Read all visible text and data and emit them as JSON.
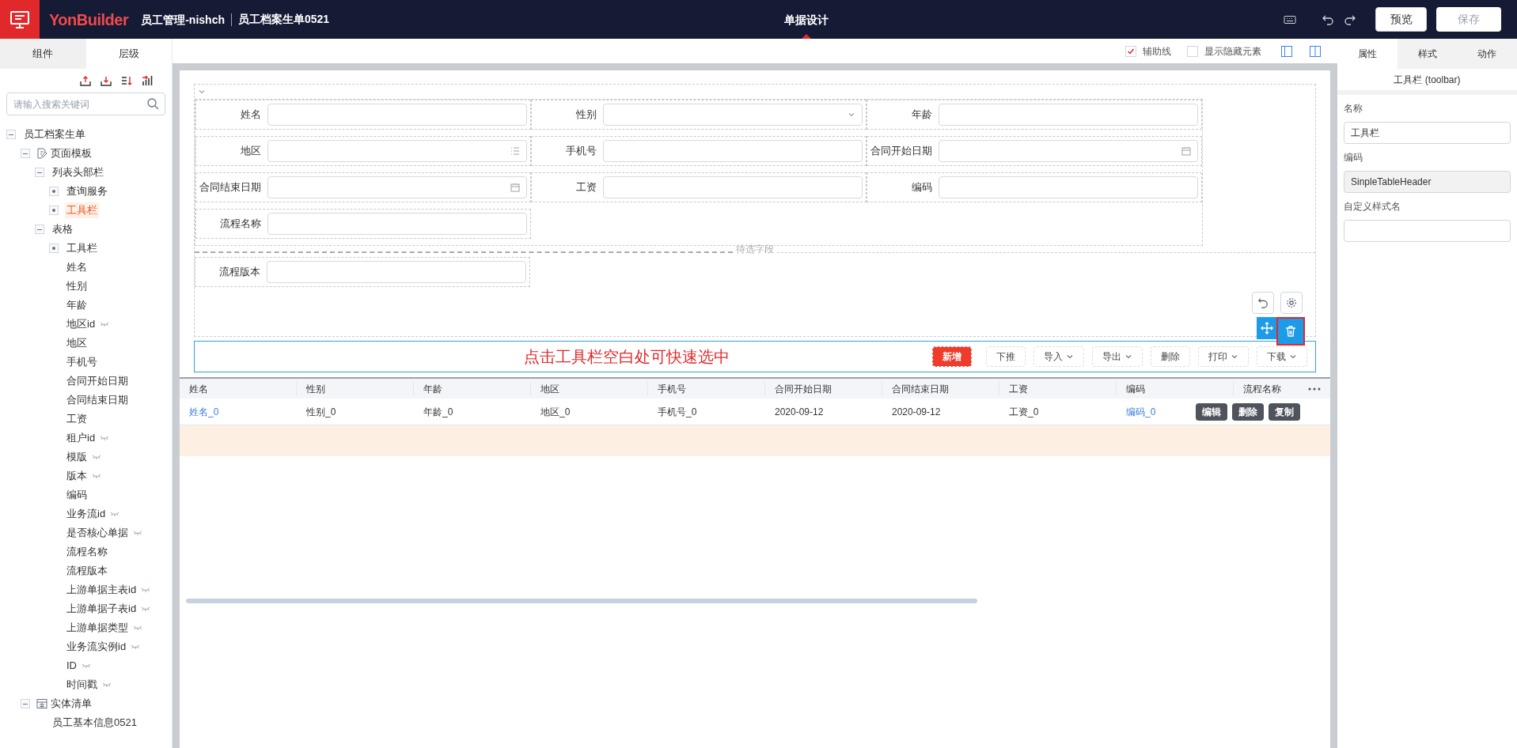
{
  "header": {
    "brand": "YonBuilder",
    "app": "员工管理-nishch",
    "doc": "员工档案生单0521",
    "center_title": "单据设计",
    "buttons": [
      {
        "label": "预览",
        "disabled": false
      },
      {
        "label": "保存",
        "disabled": true
      }
    ]
  },
  "left_tabs": [
    {
      "label": "组件",
      "selected": false
    },
    {
      "label": "层级",
      "selected": true
    }
  ],
  "search": {
    "placeholder": "请输入搜索关键词"
  },
  "tree": [
    {
      "label": "员工档案生单",
      "kind": "node",
      "expanded": true,
      "selected": false,
      "children": [
        {
          "label": "页面模板",
          "kind": "page",
          "expanded": true,
          "selected": false,
          "children": [
            {
              "label": "列表头部栏",
              "kind": "node",
              "expanded": true,
              "selected": false,
              "children": [
                {
                  "label": "查询服务",
                  "kind": "node",
                  "expanded": false,
                  "selected": false
                },
                {
                  "label": "工具栏",
                  "kind": "node",
                  "expanded": false,
                  "selected": true
                }
              ]
            },
            {
              "label": "表格",
              "kind": "node",
              "expanded": true,
              "selected": false,
              "children": [
                {
                  "label": "工具栏",
                  "kind": "node",
                  "expanded": false,
                  "selected": false
                },
                {
                  "label": "姓名",
                  "kind": "field",
                  "hidden": false,
                  "selected": false
                },
                {
                  "label": "性别",
                  "kind": "field",
                  "hidden": false,
                  "selected": false
                },
                {
                  "label": "年龄",
                  "kind": "field",
                  "hidden": false,
                  "selected": false
                },
                {
                  "label": "地区id",
                  "kind": "field",
                  "hidden": true,
                  "selected": false
                },
                {
                  "label": "地区",
                  "kind": "field",
                  "hidden": false,
                  "selected": false
                },
                {
                  "label": "手机号",
                  "kind": "field",
                  "hidden": false,
                  "selected": false
                },
                {
                  "label": "合同开始日期",
                  "kind": "field",
                  "hidden": false,
                  "selected": false
                },
                {
                  "label": "合同结束日期",
                  "kind": "field",
                  "hidden": false,
                  "selected": false
                },
                {
                  "label": "工资",
                  "kind": "field",
                  "hidden": false,
                  "selected": false
                },
                {
                  "label": "租户id",
                  "kind": "field",
                  "hidden": true,
                  "selected": false
                },
                {
                  "label": "模版",
                  "kind": "field",
                  "hidden": true,
                  "selected": false
                },
                {
                  "label": "版本",
                  "kind": "field",
                  "hidden": true,
                  "selected": false
                },
                {
                  "label": "编码",
                  "kind": "field",
                  "hidden": false,
                  "selected": false
                },
                {
                  "label": "业务流id",
                  "kind": "field",
                  "hidden": true,
                  "selected": false
                },
                {
                  "label": "是否核心单据",
                  "kind": "field",
                  "hidden": true,
                  "selected": false
                },
                {
                  "label": "流程名称",
                  "kind": "field",
                  "hidden": false,
                  "selected": false
                },
                {
                  "label": "流程版本",
                  "kind": "field",
                  "hidden": false,
                  "selected": false
                },
                {
                  "label": "上游单据主表id",
                  "kind": "field",
                  "hidden": true,
                  "selected": false
                },
                {
                  "label": "上游单据子表id",
                  "kind": "field",
                  "hidden": true,
                  "selected": false
                },
                {
                  "label": "上游单据类型",
                  "kind": "field",
                  "hidden": true,
                  "selected": false
                },
                {
                  "label": "业务流实例id",
                  "kind": "field",
                  "hidden": true,
                  "selected": false
                },
                {
                  "label": "ID",
                  "kind": "field",
                  "hidden": true,
                  "selected": false
                },
                {
                  "label": "时间戳",
                  "kind": "field",
                  "hidden": true,
                  "selected": false
                }
              ]
            }
          ]
        },
        {
          "label": "实体清单",
          "kind": "entity",
          "expanded": true,
          "selected": false,
          "children": [
            {
              "label": "员工基本信息0521",
              "kind": "field",
              "hidden": false,
              "selected": false
            }
          ]
        }
      ]
    }
  ],
  "canvas_options": [
    {
      "label": "辅助线",
      "checked": true
    },
    {
      "label": "显示隐藏元素",
      "checked": false
    }
  ],
  "form": {
    "fields": [
      {
        "label": "姓名",
        "kind": "text"
      },
      {
        "label": "性别",
        "kind": "select"
      },
      {
        "label": "年龄",
        "kind": "text"
      },
      {
        "label": "地区",
        "kind": "list"
      },
      {
        "label": "手机号",
        "kind": "text"
      },
      {
        "label": "合同开始日期",
        "kind": "date"
      },
      {
        "label": "合同结束日期",
        "kind": "date"
      },
      {
        "label": "工资",
        "kind": "text"
      },
      {
        "label": "编码",
        "kind": "text"
      },
      {
        "label": "流程名称",
        "kind": "text"
      }
    ],
    "pending_label": "待选字段",
    "pending_fields": [
      {
        "label": "流程版本",
        "kind": "text"
      }
    ]
  },
  "toolbar": {
    "hint": "点击工具栏空白处可快速选中",
    "buttons": [
      {
        "label": "新增",
        "primary": true,
        "dropdown": false
      },
      {
        "label": "下推",
        "primary": false,
        "dropdown": false
      },
      {
        "label": "导入",
        "primary": false,
        "dropdown": true
      },
      {
        "label": "导出",
        "primary": false,
        "dropdown": true
      },
      {
        "label": "删除",
        "primary": false,
        "dropdown": false
      },
      {
        "label": "打印",
        "primary": false,
        "dropdown": true
      },
      {
        "label": "下载",
        "primary": false,
        "dropdown": true
      }
    ]
  },
  "table": {
    "columns": [
      "姓名",
      "性别",
      "年龄",
      "地区",
      "手机号",
      "合同开始日期",
      "合同结束日期",
      "工资",
      "编码",
      "流程名称"
    ],
    "rows": [
      {
        "cells": [
          {
            "text": "姓名_0",
            "link": true
          },
          {
            "text": "性别_0",
            "link": false
          },
          {
            "text": "年龄_0",
            "link": false
          },
          {
            "text": "地区_0",
            "link": false
          },
          {
            "text": "手机号_0",
            "link": false
          },
          {
            "text": "2020-09-12",
            "link": false
          },
          {
            "text": "2020-09-12",
            "link": false
          },
          {
            "text": "工资_0",
            "link": false
          },
          {
            "text": "编码_0",
            "link": true
          }
        ],
        "actions": [
          "编辑",
          "删除",
          "复制"
        ]
      }
    ]
  },
  "right_tabs": [
    {
      "label": "属性",
      "selected": true
    },
    {
      "label": "样式",
      "selected": false
    },
    {
      "label": "动作",
      "selected": false
    }
  ],
  "properties": {
    "title": "工具栏 (toolbar)",
    "fields": [
      {
        "label": "名称",
        "value": "工具栏",
        "disabled": false
      },
      {
        "label": "编码",
        "value": "SinpleTableHeader",
        "disabled": true
      },
      {
        "label": "自定义样式名",
        "disabled": false
      }
    ]
  }
}
